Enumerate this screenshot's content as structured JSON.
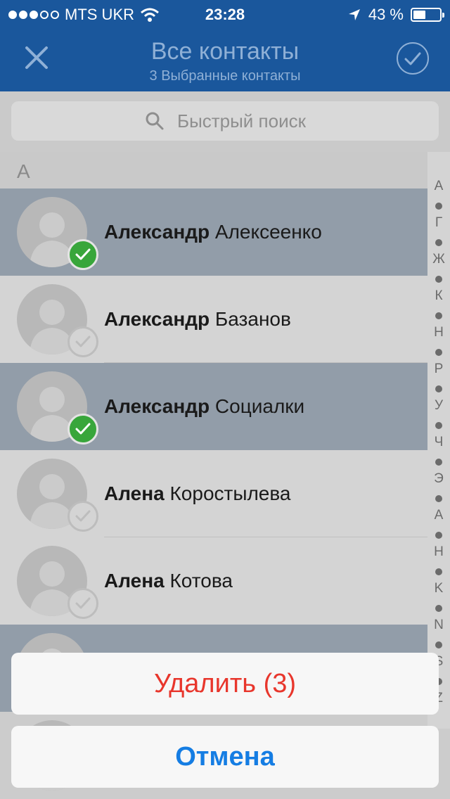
{
  "status_bar": {
    "carrier": "MTS UKR",
    "signal_bars_filled": 3,
    "signal_bars_total": 5,
    "time": "23:28",
    "battery": "43 %"
  },
  "nav": {
    "title": "Все контакты",
    "subtitle": "3 Выбранные контакты"
  },
  "search": {
    "placeholder": "Быстрый поиск"
  },
  "section": "А",
  "contacts": [
    {
      "first": "Александр",
      "last": "Алексеенко",
      "selected": true
    },
    {
      "first": "Александр",
      "last": "Базанов",
      "selected": false
    },
    {
      "first": "Александр",
      "last": "Социалки",
      "selected": true
    },
    {
      "first": "Алена",
      "last": "Коростылева",
      "selected": false
    },
    {
      "first": "Алена",
      "last": "Котова",
      "selected": false
    }
  ],
  "index": [
    "А",
    "Г",
    "Ж",
    "К",
    "Н",
    "Р",
    "У",
    "Ч",
    "Э",
    "A",
    "H",
    "K",
    "N",
    "S",
    "Z"
  ],
  "action_sheet": {
    "delete_label": "Удалить (3)",
    "cancel_label": "Отмена"
  },
  "colors": {
    "nav_bar": "#1a579c",
    "delete_text": "#e8362c",
    "cancel_text": "#157de3",
    "selected_check": "#38a63b"
  }
}
